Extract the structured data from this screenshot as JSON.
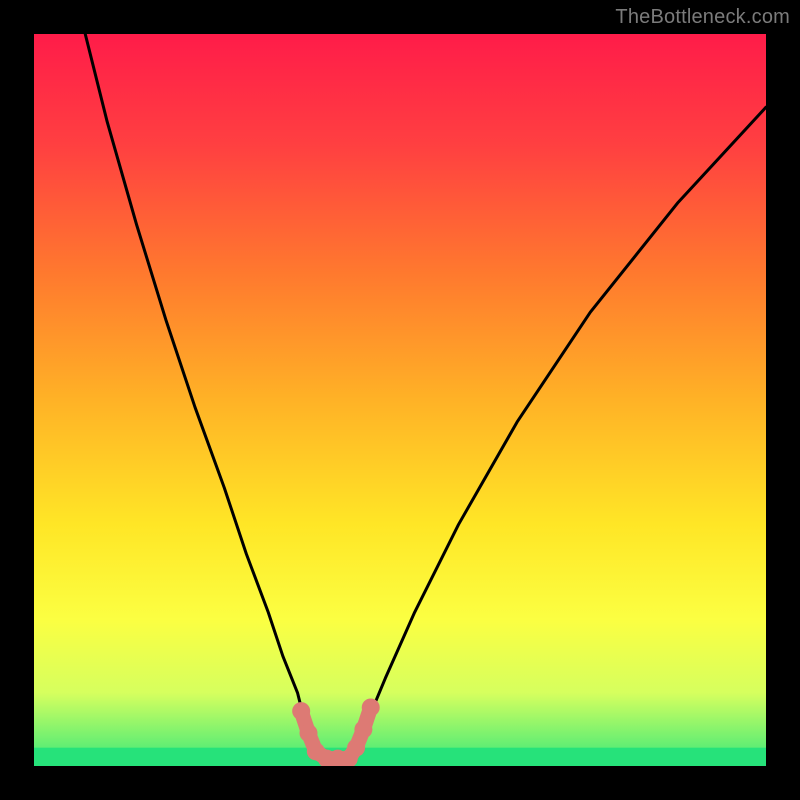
{
  "watermark": "TheBottleneck.com",
  "chart_data": {
    "type": "line",
    "title": "",
    "xlabel": "",
    "ylabel": "",
    "xlim": [
      0,
      100
    ],
    "ylim": [
      0,
      100
    ],
    "legend": false,
    "grid": false,
    "series": [
      {
        "name": "bottleneck-curve",
        "x": [
          7,
          10,
          14,
          18,
          22,
          26,
          29,
          32,
          34,
          36,
          37,
          38,
          40,
          43,
          44,
          45.5,
          48,
          52,
          58,
          66,
          76,
          88,
          100
        ],
        "y": [
          100,
          88,
          74,
          61,
          49,
          38,
          29,
          21,
          15,
          10,
          6,
          3,
          1,
          1,
          3,
          6,
          12,
          21,
          33,
          47,
          62,
          77,
          90
        ]
      }
    ],
    "markers": {
      "name": "highlight-dots",
      "color": "#dd7a74",
      "points": [
        {
          "x": 36.5,
          "y": 7.5
        },
        {
          "x": 37.5,
          "y": 4.5
        },
        {
          "x": 38.5,
          "y": 2.0
        },
        {
          "x": 40.0,
          "y": 1.0
        },
        {
          "x": 41.5,
          "y": 1.0
        },
        {
          "x": 43.0,
          "y": 1.0
        },
        {
          "x": 44.0,
          "y": 2.5
        },
        {
          "x": 45.0,
          "y": 5.0
        },
        {
          "x": 46.0,
          "y": 8.0
        }
      ]
    },
    "bottom_band": {
      "name": "green-floor",
      "y_from": 0,
      "y_to": 2.5,
      "color": "#26e27a"
    }
  }
}
